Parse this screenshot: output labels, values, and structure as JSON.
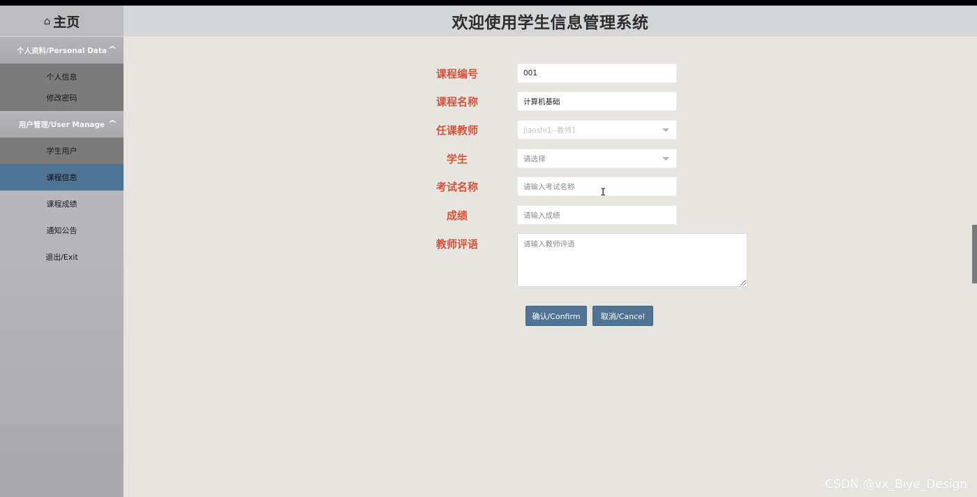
{
  "sidebar": {
    "home_icon": "home-icon",
    "home_label": "主页",
    "groups": [
      {
        "label": "个人资料/Personal Data",
        "icon": "chevron-up-icon",
        "items": [
          "个人信息",
          "修改密码"
        ]
      },
      {
        "label": "用户管理/User Manage",
        "icon": "chevron-up-icon"
      }
    ],
    "items": [
      "学生用户",
      "课程信息",
      "课程成绩",
      "通知公告",
      "退出/Exit"
    ]
  },
  "header": {
    "title": "欢迎使用学生信息管理系统"
  },
  "form": {
    "course_code": {
      "label": "课程编号",
      "value": "001"
    },
    "course_name": {
      "label": "课程名称",
      "value": "计算机基础"
    },
    "teacher": {
      "label": "任课教师",
      "value": "jiaoshi1--教师1"
    },
    "student": {
      "label": "学生",
      "value": "请选择"
    },
    "exam_name": {
      "label": "考试名称",
      "placeholder": "请输入考试名称"
    },
    "score": {
      "label": "成绩",
      "placeholder": "请输入成绩"
    },
    "comment": {
      "label": "教师评语",
      "placeholder": "请输入教师评语"
    },
    "confirm_label": "确认/Confirm",
    "cancel_label": "取消/Cancel"
  },
  "watermark": "CSDN @vx_Biye_Design",
  "colors": {
    "accent": "#4f7393",
    "label": "#d6533b"
  }
}
